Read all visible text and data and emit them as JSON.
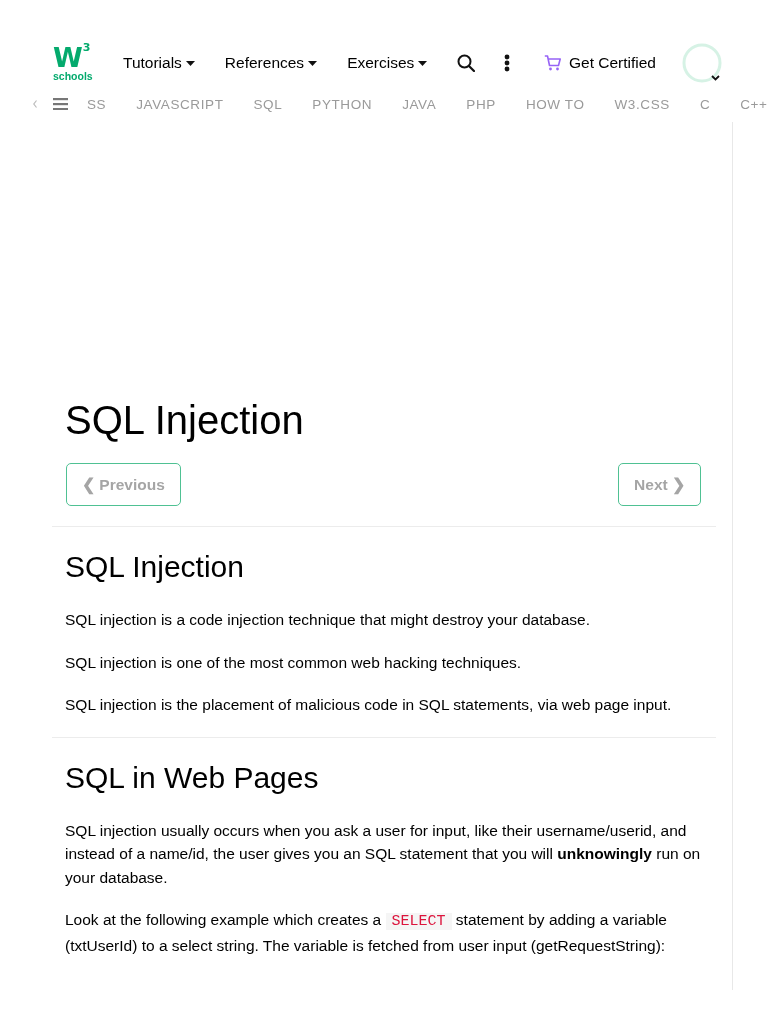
{
  "header": {
    "logo": {
      "mark": "W",
      "superscript": "3",
      "wordmark": "schools"
    },
    "menus": [
      {
        "label": "Tutorials"
      },
      {
        "label": "References"
      },
      {
        "label": "Exercises"
      }
    ],
    "certified": {
      "label": "Get Certified"
    }
  },
  "topics": {
    "items": [
      {
        "label": "SS"
      },
      {
        "label": "JAVASCRIPT"
      },
      {
        "label": "SQL"
      },
      {
        "label": "PYTHON"
      },
      {
        "label": "JAVA"
      },
      {
        "label": "PHP"
      },
      {
        "label": "HOW TO"
      },
      {
        "label": "W3.CSS"
      },
      {
        "label": "C"
      },
      {
        "label": "C++"
      }
    ]
  },
  "article": {
    "title": "SQL Injection",
    "pager": {
      "previous": "❮ Previous",
      "next": "Next ❯"
    },
    "sections": [
      {
        "heading": "SQL Injection",
        "paragraphs": [
          {
            "parts": [
              {
                "kind": "text",
                "text": "SQL injection is a code injection technique that might destroy your database."
              }
            ]
          },
          {
            "parts": [
              {
                "kind": "text",
                "text": "SQL injection is one of the most common web hacking techniques."
              }
            ]
          },
          {
            "parts": [
              {
                "kind": "text",
                "text": "SQL injection is the placement of malicious code in SQL statements, via web page input."
              }
            ]
          }
        ]
      },
      {
        "heading": "SQL in Web Pages",
        "paragraphs": [
          {
            "parts": [
              {
                "kind": "text",
                "text": "SQL injection usually occurs when you ask a user for input, like their username/userid, and instead of a name/id, the user gives you an SQL statement that you will **unknowingly** run on your database."
              }
            ]
          },
          {
            "parts": [
              {
                "kind": "text",
                "text": "Look at the following example which creates a "
              },
              {
                "kind": "code",
                "text": "SELECT"
              },
              {
                "kind": "text",
                "text": " statement by adding a variable (txtUserId) to a select string. The variable is fetched from user input (getRequestString):"
              }
            ]
          }
        ]
      }
    ]
  }
}
